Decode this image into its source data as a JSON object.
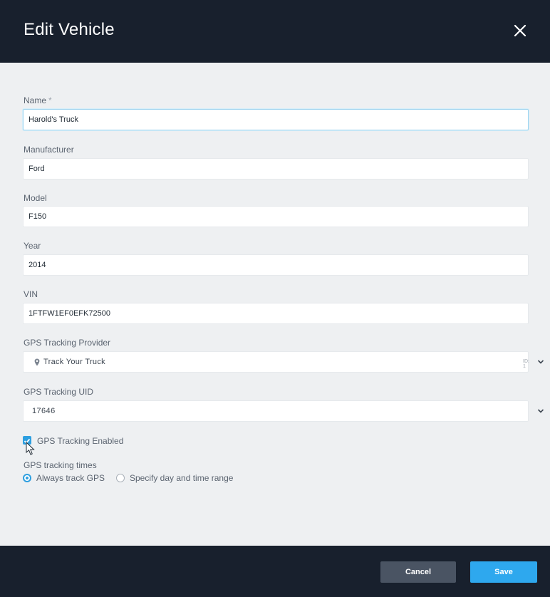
{
  "dialog": {
    "title": "Edit Vehicle"
  },
  "fields": {
    "name": {
      "label": "Name",
      "required_mark": "*",
      "value": "Harold's Truck"
    },
    "manufacturer": {
      "label": "Manufacturer",
      "value": "Ford"
    },
    "model": {
      "label": "Model",
      "value": "F150"
    },
    "year": {
      "label": "Year",
      "value": "2014"
    },
    "vin": {
      "label": "VIN",
      "value": "1FTFW1EF0EFK72500"
    },
    "gps_provider": {
      "label": "GPS Tracking Provider",
      "value": "Track Your Truck",
      "badge": "ID: 1"
    },
    "gps_uid": {
      "label": "GPS Tracking UID",
      "value": "17646"
    }
  },
  "gps_enabled": {
    "label": "GPS Tracking Enabled",
    "checked": true
  },
  "tracking_times": {
    "label": "GPS tracking times",
    "options": [
      {
        "label": "Always track GPS",
        "selected": true
      },
      {
        "label": "Specify day and time range",
        "selected": false
      }
    ]
  },
  "footer": {
    "cancel_label": "Cancel",
    "save_label": "Save"
  },
  "colors": {
    "accent": "#2ea8ee",
    "header_bg": "#18202d",
    "body_bg": "#eef0f2",
    "cancel_bg": "#4a5463"
  },
  "icons": {
    "close": "close-icon",
    "provider": "map-pin-icon",
    "dropdown": "chevron-down-icon",
    "cursor": "mouse-cursor-icon"
  }
}
